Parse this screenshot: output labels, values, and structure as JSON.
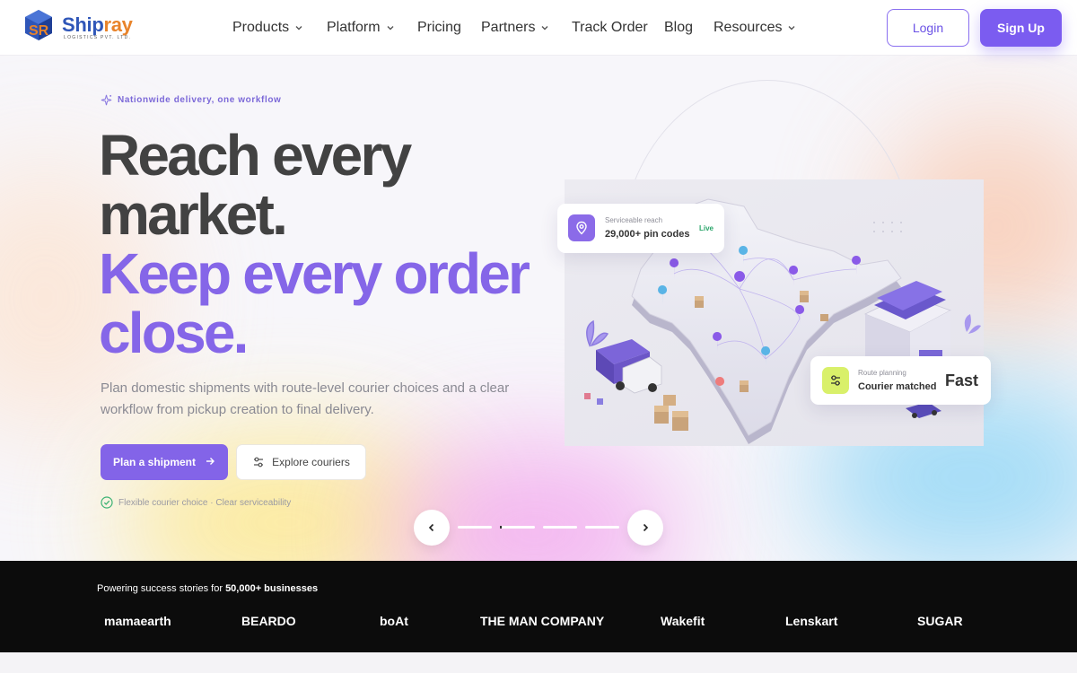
{
  "brand": {
    "name_main": "Ship",
    "name_accent": "ray",
    "tagline": "LOGISTICS PVT. LTD."
  },
  "nav": {
    "items": [
      {
        "label": "Products",
        "has_dropdown": true
      },
      {
        "label": "Platform",
        "has_dropdown": true
      },
      {
        "label": "Pricing",
        "has_dropdown": false
      },
      {
        "label": "Partners",
        "has_dropdown": true
      },
      {
        "label": "Track Order",
        "has_dropdown": false
      },
      {
        "label": "Blog",
        "has_dropdown": false
      },
      {
        "label": "Resources",
        "has_dropdown": true
      }
    ],
    "login_label": "Login",
    "signup_label": "Sign Up"
  },
  "hero": {
    "eyebrow": "Nationwide delivery, one workflow",
    "headline_line1": "Reach every",
    "headline_line2": "market.",
    "headline_line3": "Keep every order",
    "headline_line4": "close.",
    "lead": "Plan domestic shipments with route-level courier choices and a clear workflow from pickup creation to final delivery.",
    "primary_cta": "Plan a shipment",
    "secondary_cta": "Explore couriers",
    "note": "Flexible courier choice · Clear serviceability"
  },
  "cards": {
    "reach": {
      "label": "Serviceable reach",
      "value": "29,000+ pin codes",
      "badge": "Live"
    },
    "route": {
      "label": "Route planning",
      "value": "Courier matched",
      "highlight": "Fast"
    }
  },
  "carousel": {
    "slide_count": 4,
    "active_index": 1
  },
  "logo_strip": {
    "title_prefix": "Powering success stories for ",
    "title_bold": "50,000+ businesses",
    "brands": [
      "mamaearth",
      "BEARDO",
      "boAt",
      "THE MAN COMPANY",
      "Wakefit",
      "Lenskart",
      "SUGAR"
    ]
  },
  "colors": {
    "accent": "#7b5cf0",
    "headline_purple": "#8566e8",
    "headline_dark": "#424242",
    "logo_blue": "#2f56b8",
    "logo_orange": "#e8832a",
    "live_green": "#2aa56a",
    "strip_bg": "#0c0c0c"
  }
}
